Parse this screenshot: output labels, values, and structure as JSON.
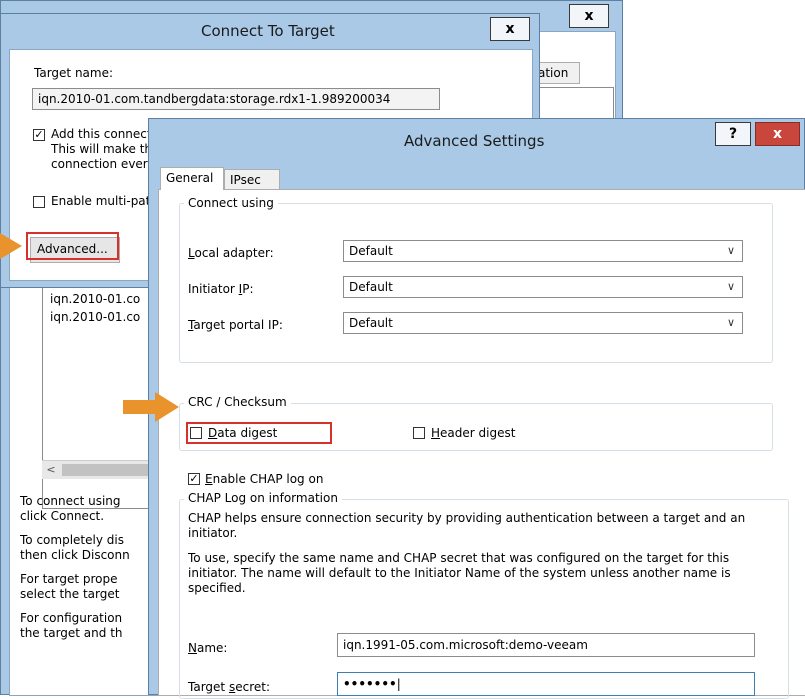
{
  "back_window": {
    "close_label": "x",
    "tab_partial": "ation",
    "list_items": [
      "iqn.2010-01.co",
      "iqn.2010-01.co"
    ],
    "scroll_left": "<",
    "help_paragraphs": [
      [
        "To connect using",
        "click Connect."
      ],
      [
        "To completely dis",
        "then click Disconn"
      ],
      [
        "For target prope",
        "select the target"
      ],
      [
        "For configuration",
        "the target and th"
      ]
    ]
  },
  "connect_dialog": {
    "title": "Connect To Target",
    "close_label": "x",
    "target_name_label": "Target name:",
    "target_name_value": "iqn.2010-01.com.tandbergdata:storage.rdx1-1.989200034",
    "add_connection_label": "Add this connect",
    "add_connection_check": "✓",
    "add_connection_note_1": "This will make th",
    "add_connection_note_2": "connection ever",
    "multipath_label": "Enable multi-path",
    "advanced_button": "Advanced..."
  },
  "advanced_dialog": {
    "title": "Advanced Settings",
    "help_label": "?",
    "close_label": "x",
    "tabs": [
      "General",
      "IPsec"
    ],
    "connect_using": {
      "legend": "Connect using",
      "local_adapter_label": "Local adapter:",
      "local_adapter_value": "Default",
      "initiator_ip_label": "Initiator IP:",
      "initiator_ip_value": "Default",
      "target_portal_label": "Target portal IP:",
      "target_portal_value": "Default"
    },
    "crc": {
      "legend": "CRC / Checksum",
      "data_digest_label": "Data digest",
      "header_digest_label": "Header digest"
    },
    "chap": {
      "enable_label": "Enable CHAP log on",
      "enable_check": "✓",
      "legend": "CHAP Log on information",
      "desc_1": "CHAP helps ensure connection security by providing authentication between a target and an initiator.",
      "desc_2": "To use, specify the same name and CHAP secret that was configured on the target for this initiator.  The name will default to the Initiator Name of the system unless another name is specified.",
      "name_label": "Name:",
      "name_value": "iqn.1991-05.com.microsoft:demo-veeam",
      "secret_label": "Target secret:",
      "secret_value": "•••••••"
    }
  },
  "colors": {
    "frame": "#a9c9e6",
    "highlight": "#d9302a",
    "callout_arrow": "#e8932c",
    "close_red": "#c9463d"
  }
}
